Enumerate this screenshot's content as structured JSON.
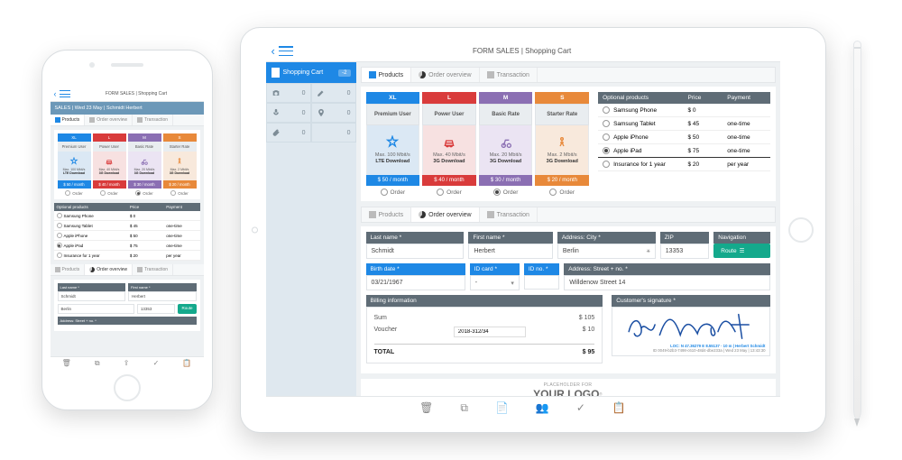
{
  "header_title": "FORM SALES | Shopping Cart",
  "phone_sub": "SALES | Wed 23 May | Schmidt Herbert",
  "tabs": [
    "Products",
    "Order overview",
    "Transaction"
  ],
  "sidebar": {
    "main_label": "Shopping Cart",
    "main_count": "-2",
    "cells": [
      "0",
      "0",
      "0",
      "0",
      "0",
      "0"
    ]
  },
  "plans": [
    {
      "code": "XL",
      "label": "Premium User",
      "speed_top": "Max. 100 Mbit/s",
      "speed_bold": "LTE Download",
      "price": "$ 50 / month",
      "color": "#1e88e5",
      "body": "#dbe8f4"
    },
    {
      "code": "L",
      "label": "Power User",
      "speed_top": "Max. 40 Mbit/s",
      "speed_bold": "3G Download",
      "price": "$ 40 / month",
      "color": "#d93b3b",
      "body": "#f7e1e1"
    },
    {
      "code": "M",
      "label": "Basic Rate",
      "speed_top": "Max. 20 Mbit/s",
      "speed_bold": "3G Download",
      "price": "$ 30 / month",
      "color": "#8b6fb3",
      "body": "#ebe4f3"
    },
    {
      "code": "S",
      "label": "Starter Rate",
      "speed_top": "Max. 2 Mbit/s",
      "speed_bold": "3G Download",
      "price": "$ 20 / month",
      "color": "#e8893a",
      "body": "#f8e9dc"
    }
  ],
  "order_label": "Order",
  "selected_plan_index": 2,
  "opt_header": [
    "Optional products",
    "Price",
    "Payment"
  ],
  "opts": [
    {
      "name": "Samsung Phone",
      "price": "$ 0",
      "payment": ""
    },
    {
      "name": "Samsung Tablet",
      "price": "$ 45",
      "payment": "one-time"
    },
    {
      "name": "Apple iPhone",
      "price": "$ 50",
      "payment": "one-time"
    },
    {
      "name": "Apple iPad",
      "price": "$ 75",
      "payment": "one-time"
    },
    {
      "name": "Insurance for 1 year",
      "price": "$ 20",
      "payment": "per year"
    }
  ],
  "opt_selected_index": 3,
  "overview": {
    "last_name": {
      "label": "Last name *",
      "value": "Schmidt"
    },
    "first_name": {
      "label": "First name *",
      "value": "Herbert"
    },
    "city": {
      "label": "Address: City *",
      "value": "Berlin"
    },
    "zip": {
      "label": "ZIP",
      "value": "13353"
    },
    "nav": {
      "label": "Navigation",
      "button": "Route"
    },
    "birth": {
      "label": "Birth date *",
      "value": "03/21/1967"
    },
    "idcard": {
      "label": "ID card *",
      "value": "-"
    },
    "idno": {
      "label": "ID no. *",
      "value": ""
    },
    "street": {
      "label": "Address: Street + no. *",
      "value": "Willdenow Street 14"
    }
  },
  "billing": {
    "header": "Billing information",
    "sum_label": "Sum",
    "sum_value": "$ 105",
    "voucher_label": "Voucher",
    "voucher_value": "2018-312/34",
    "voucher_amount": "$ 10",
    "total_label": "TOTAL",
    "total_value": "$ 95"
  },
  "signature": {
    "header": "Customer's signature *",
    "meta_top": "LOC: N 47.36279 E 8.55137 · 10 m | Herbert Schmidt",
    "meta_bot": "ID 0049-b2b3-7498-c610-48d4-dbe233a | Wed 23 May | 13:43:30"
  },
  "logo": {
    "top": "PLACEHOLDER FOR",
    "main": "YOUR LOGO"
  }
}
